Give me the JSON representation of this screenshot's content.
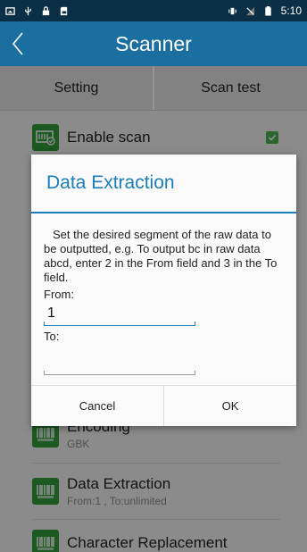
{
  "status_bar": {
    "time": "5:10",
    "icons": [
      "screen-icon",
      "usb-icon",
      "lock-icon",
      "sd-card-icon",
      "vibrate-icon",
      "no-signal-icon",
      "battery-icon"
    ]
  },
  "app_bar": {
    "title": "Scanner",
    "back_icon": "chevron-left-icon"
  },
  "tabs": [
    {
      "label": "Setting"
    },
    {
      "label": "Scan test"
    }
  ],
  "settings": {
    "enable_scan": {
      "title": "Enable scan",
      "checked": true
    },
    "encoding": {
      "title": "Encoding",
      "subtitle": "GBK"
    },
    "data_extraction": {
      "title": "Data Extraction",
      "subtitle": "From:1 , To:unlimited"
    },
    "char_replacement": {
      "title": "Character Replacement"
    }
  },
  "dialog": {
    "title": "Data Extraction",
    "message": "Set the desired segment of the raw data to be outputted, e.g. To output bc in raw data abcd, enter 2 in the From field and 3 in the To field.",
    "from_label": "From:",
    "from_value": "1",
    "to_label": "To:",
    "to_value": "",
    "cancel_label": "Cancel",
    "ok_label": "OK"
  },
  "colors": {
    "accent": "#1a7eb8",
    "app_bar": "#1a6fa0",
    "status_bar": "#0b2f44",
    "icon_green": "#2f9a3a"
  }
}
